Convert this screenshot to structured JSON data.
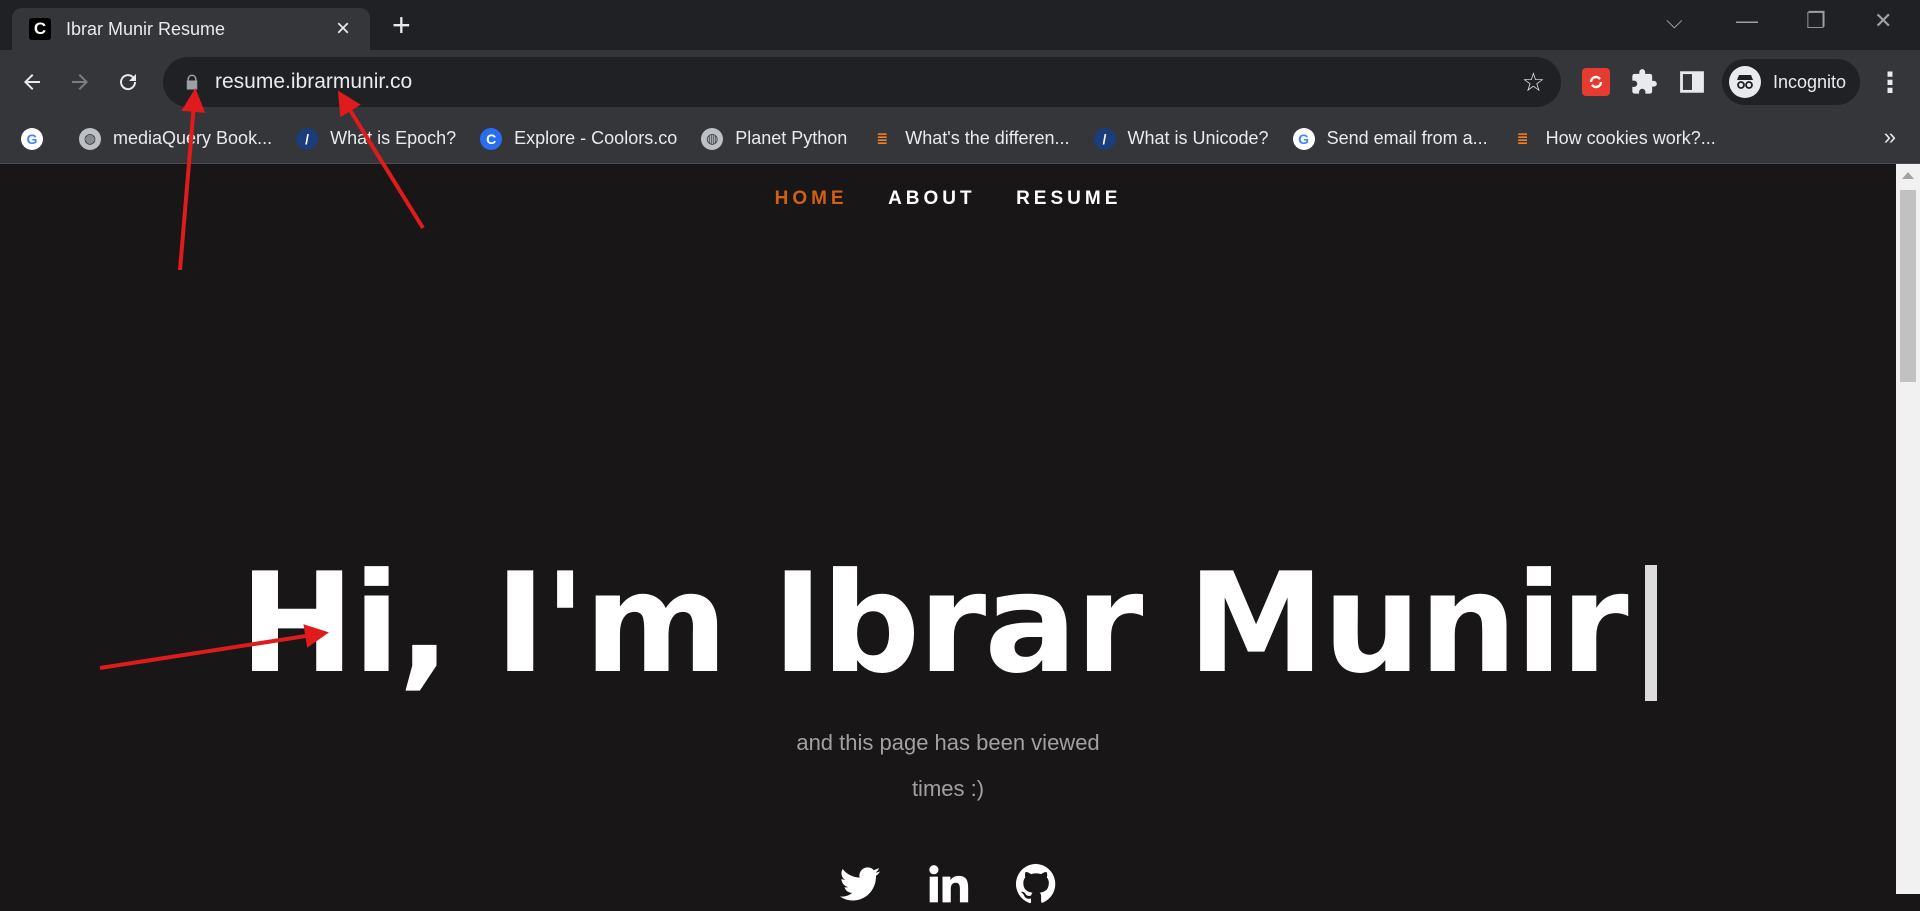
{
  "tab": {
    "title": "Ibrar Munir Resume",
    "favicon_letter": "C",
    "close_icon": "×",
    "new_tab_icon": "+"
  },
  "window_controls": {
    "dropdown": "⌵",
    "minimize": "—",
    "restore": "❐",
    "close": "✕"
  },
  "toolbar": {
    "url": "resume.ibrarmunir.co",
    "profile_label": "Incognito",
    "menu": "⋮"
  },
  "bookmarks": [
    {
      "label": "",
      "icon": "google-icon"
    },
    {
      "label": "mediaQuery Book...",
      "icon": "globe-icon"
    },
    {
      "label": "What is Epoch?",
      "icon": "slash-icon"
    },
    {
      "label": "Explore - Coolors.co",
      "icon": "coolors-icon"
    },
    {
      "label": "Planet Python",
      "icon": "globe-icon"
    },
    {
      "label": "What's the differen...",
      "icon": "stackoverflow-icon"
    },
    {
      "label": "What is Unicode?",
      "icon": "slash-icon"
    },
    {
      "label": "Send email from a...",
      "icon": "google-icon"
    },
    {
      "label": "How cookies work?...",
      "icon": "stackoverflow-icon"
    }
  ],
  "bookmarks_overflow": "»",
  "site_nav": {
    "home": "HOME",
    "about": "ABOUT",
    "resume": "RESUME"
  },
  "hero": {
    "headline": "Hi, I'm Ibrar Munir"
  },
  "subtitle": {
    "line1": "and this page has been viewed",
    "line2": "times :)"
  },
  "socials": [
    "twitter-icon",
    "linkedin-icon",
    "github-icon"
  ],
  "colors": {
    "accent": "#d25f16",
    "page_bg": "#181617",
    "chrome_bg": "#35363a",
    "annotation": "#e01b1b"
  }
}
